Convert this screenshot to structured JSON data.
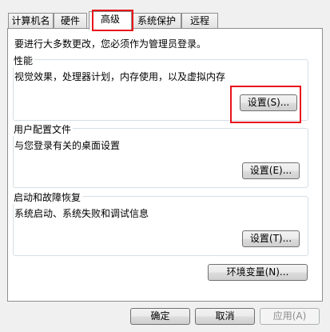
{
  "tabs": [
    "计算机名",
    "硬件",
    "高级",
    "系统保护",
    "远程"
  ],
  "intro_text": "要进行大多数更改，您必须作为管理员登录。",
  "performance": {
    "title": "性能",
    "description": "视觉效果，处理器计划，内存使用，以及虚拟内存",
    "button": "设置(S)..."
  },
  "user_profiles": {
    "title": "用户配置文件",
    "description": "与您登录有关的桌面设置",
    "button": "设置(E)..."
  },
  "startup_recovery": {
    "title": "启动和故障恢复",
    "description": "系统启动、系统失败和调试信息",
    "button": "设置(T)..."
  },
  "env_vars_button": "环境变量(N)...",
  "footer": {
    "ok": "确定",
    "cancel": "取消",
    "apply": "应用(A)"
  },
  "colors": {
    "highlight": "#e8141b",
    "panel_bg": "#ffffff",
    "window_bg": "#f0f0f0"
  }
}
